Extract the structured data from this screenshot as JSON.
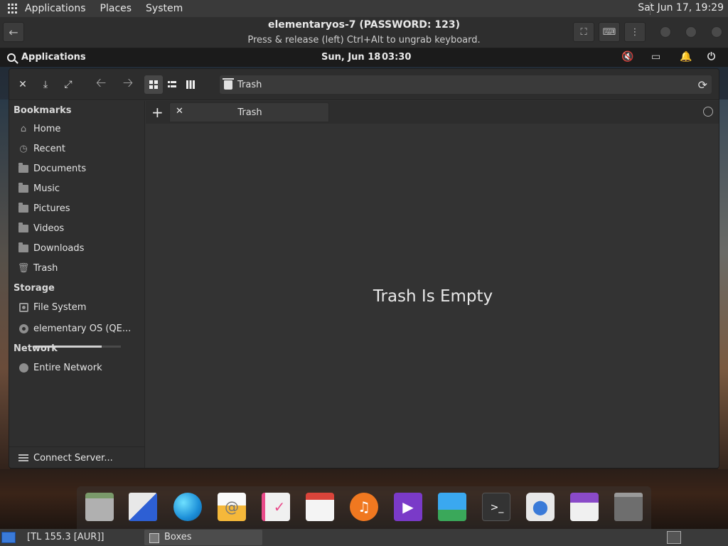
{
  "host_menubar": {
    "items": [
      "Applications",
      "Places",
      "System"
    ],
    "clock": "Sat Jun 17, 19:29"
  },
  "vm_header": {
    "title": "elementaryos-7 (PASSWORD: 123)",
    "subtitle": "Press & release (left) Ctrl+Alt to ungrab keyboard."
  },
  "guest_panel": {
    "applications": "Applications",
    "date": "Sun, Jun 18",
    "time": "03:30"
  },
  "file_manager": {
    "path": "Trash",
    "sidebar": {
      "bookmarks_heading": "Bookmarks",
      "bookmarks": [
        {
          "label": "Home",
          "icon": "home-icon"
        },
        {
          "label": "Recent",
          "icon": "recent-icon"
        },
        {
          "label": "Documents",
          "icon": "folder-icon"
        },
        {
          "label": "Music",
          "icon": "folder-icon"
        },
        {
          "label": "Pictures",
          "icon": "folder-icon"
        },
        {
          "label": "Videos",
          "icon": "folder-icon"
        },
        {
          "label": "Downloads",
          "icon": "folder-icon"
        },
        {
          "label": "Trash",
          "icon": "trash-icon"
        }
      ],
      "storage_heading": "Storage",
      "storage": [
        {
          "label": "File System",
          "icon": "drive-icon",
          "usage_fraction": 0.78
        },
        {
          "label": "elementary OS (QE...",
          "icon": "optical-disc-icon"
        }
      ],
      "network_heading": "Network",
      "network": [
        {
          "label": "Entire Network",
          "icon": "network-icon"
        }
      ],
      "connect_server": "Connect Server..."
    },
    "tab": {
      "label": "Trash"
    },
    "empty_message": "Trash Is Empty"
  },
  "dock": {
    "apps": [
      "files",
      "multitasking-view",
      "web-browser",
      "mail",
      "tasks",
      "calendar",
      "music",
      "videos",
      "photos",
      "terminal",
      "system-settings",
      "app-center",
      "trash"
    ]
  },
  "host_taskbar": {
    "item1": "[TL 155.3 [AUR]]",
    "item2": "Boxes"
  },
  "colors": {
    "panel": "#1b1b1b",
    "window": "#333333",
    "sidebar": "#2f2f2f",
    "host_bar": "#3a3a3a"
  }
}
